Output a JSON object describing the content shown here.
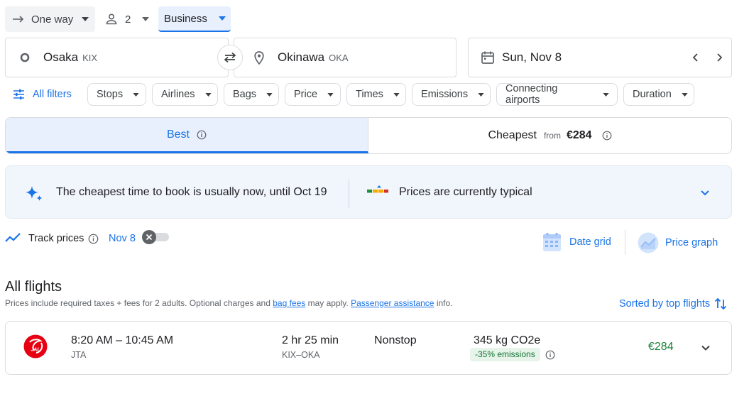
{
  "trip": {
    "type_label": "One way",
    "passengers": "2",
    "cabin": "Business"
  },
  "route": {
    "origin_city": "Osaka",
    "origin_code": "KIX",
    "dest_city": "Okinawa",
    "dest_code": "OKA",
    "date": "Sun, Nov 8"
  },
  "filters": {
    "all_filters": "All filters",
    "chips": [
      "Stops",
      "Airlines",
      "Bags",
      "Price",
      "Times",
      "Emissions",
      "Connecting airports",
      "Duration"
    ]
  },
  "tabs": {
    "best": "Best",
    "cheapest": "Cheapest",
    "cheapest_from": "from",
    "cheapest_price": "€284"
  },
  "insights": {
    "book_time": "The cheapest time to book is usually now, until Oct 19",
    "price_status": "Prices are currently typical"
  },
  "tracking": {
    "label": "Track prices",
    "date": "Nov 8",
    "toggle_on": false,
    "date_grid": "Date grid",
    "price_graph": "Price graph"
  },
  "results": {
    "heading": "All flights",
    "note_1": "Prices include required taxes + fees for 2 adults. Optional charges and ",
    "bag_fees": "bag fees",
    "note_2": " may apply. ",
    "passenger_assistance": "Passenger assistance",
    "note_3": " info.",
    "sort_label": "Sorted by top flights"
  },
  "flights": [
    {
      "times": "8:20 AM – 10:45 AM",
      "airline": "JTA",
      "airline_logo_text": "JAL",
      "duration": "2 hr 25 min",
      "route": "KIX–OKA",
      "stops": "Nonstop",
      "emissions": "345 kg CO2e",
      "emissions_badge": "-35% emissions",
      "price": "€284"
    }
  ],
  "colors": {
    "accent": "#1a73e8",
    "price_green": "#188038",
    "jal_red": "#e60012",
    "badge_bg": "#e6f4ea"
  }
}
